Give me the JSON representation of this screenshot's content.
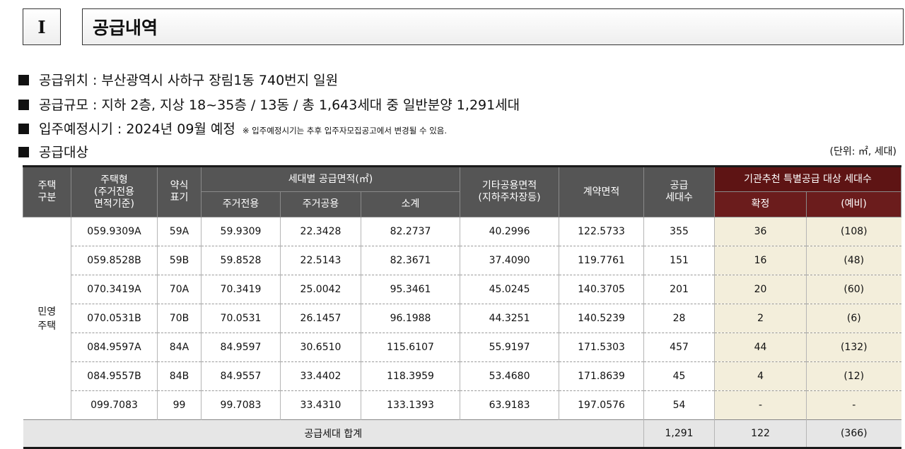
{
  "header": {
    "section_number": "I",
    "title": "공급내역"
  },
  "info": {
    "location": "공급위치 : 부산광역시 사하구 장림1동 740번지 일원",
    "scale": "공급규모 : 지하 2층, 지상 18~35층 / 13동 / 총 1,643세대 중 일반분양 1,291세대",
    "move_in": "입주예정시기 : 2024년 09월 예정",
    "move_in_note": "※ 입주예정시기는 추후 입주자모집공고에서 변경될 수 있음.",
    "target": "공급대상",
    "unit": "(단위: ㎡, 세대)"
  },
  "table": {
    "headers": {
      "category": "주택\n구분",
      "type": "주택형\n(주거전용\n면적기준)",
      "short": "약식\n표기",
      "area_group": "세대별 공급면적(㎡)",
      "exclusive": "주거전용",
      "common": "주거공용",
      "subtotal": "소계",
      "other": "기타공용면적\n(지하주차장등)",
      "contract": "계약면적",
      "supply": "공급\n세대수",
      "special_group": "기관추천 특별공급 대상 세대수",
      "confirmed": "확정",
      "reserve": "(예비)"
    },
    "group_label": "민영\n주택",
    "rows": [
      {
        "type": "059.9309A",
        "short": "59A",
        "exclusive": "59.9309",
        "common": "22.3428",
        "subtotal": "82.2737",
        "other": "40.2996",
        "contract": "122.5733",
        "supply": "355",
        "confirmed": "36",
        "reserve": "(108)"
      },
      {
        "type": "059.8528B",
        "short": "59B",
        "exclusive": "59.8528",
        "common": "22.5143",
        "subtotal": "82.3671",
        "other": "37.4090",
        "contract": "119.7761",
        "supply": "151",
        "confirmed": "16",
        "reserve": "(48)"
      },
      {
        "type": "070.3419A",
        "short": "70A",
        "exclusive": "70.3419",
        "common": "25.0042",
        "subtotal": "95.3461",
        "other": "45.0245",
        "contract": "140.3705",
        "supply": "201",
        "confirmed": "20",
        "reserve": "(60)"
      },
      {
        "type": "070.0531B",
        "short": "70B",
        "exclusive": "70.0531",
        "common": "26.1457",
        "subtotal": "96.1988",
        "other": "44.3251",
        "contract": "140.5239",
        "supply": "28",
        "confirmed": "2",
        "reserve": "(6)"
      },
      {
        "type": "084.9597A",
        "short": "84A",
        "exclusive": "84.9597",
        "common": "30.6510",
        "subtotal": "115.6107",
        "other": "55.9197",
        "contract": "171.5303",
        "supply": "457",
        "confirmed": "44",
        "reserve": "(132)"
      },
      {
        "type": "084.9557B",
        "short": "84B",
        "exclusive": "84.9557",
        "common": "33.4402",
        "subtotal": "118.3959",
        "other": "53.4680",
        "contract": "171.8639",
        "supply": "45",
        "confirmed": "4",
        "reserve": "(12)"
      },
      {
        "type": "099.7083",
        "short": "99",
        "exclusive": "99.7083",
        "common": "33.4310",
        "subtotal": "133.1393",
        "other": "63.9183",
        "contract": "197.0576",
        "supply": "54",
        "confirmed": "-",
        "reserve": "-"
      }
    ],
    "total": {
      "label": "공급세대 합계",
      "supply": "1,291",
      "confirmed": "122",
      "reserve": "(366)"
    }
  }
}
